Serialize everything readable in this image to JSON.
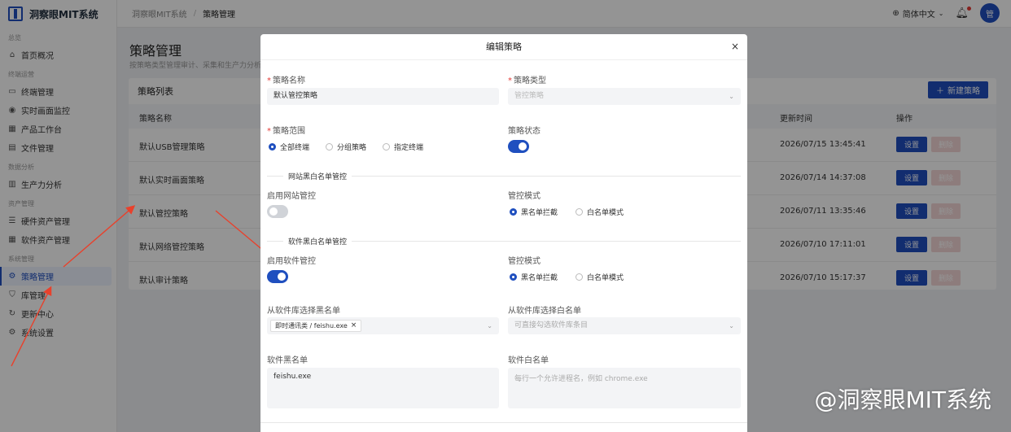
{
  "app": {
    "name": "洞察眼MIT系统"
  },
  "sidebar": {
    "groups": [
      {
        "label": "总览",
        "items": [
          {
            "label": "首页概况",
            "icon": "home-icon"
          }
        ]
      },
      {
        "label": "终端运营",
        "items": [
          {
            "label": "终端管理",
            "icon": "monitor-icon"
          },
          {
            "label": "实时画面监控",
            "icon": "eye-icon"
          },
          {
            "label": "产品工作台",
            "icon": "grid-icon"
          },
          {
            "label": "文件管理",
            "icon": "file-icon"
          }
        ]
      },
      {
        "label": "数据分析",
        "items": [
          {
            "label": "生产力分析",
            "icon": "bar-chart-icon"
          }
        ]
      },
      {
        "label": "资产管理",
        "items": [
          {
            "label": "硬件资产管理",
            "icon": "list-icon"
          },
          {
            "label": "软件资产管理",
            "icon": "grid-icon"
          }
        ]
      },
      {
        "label": "系统管理",
        "items": [
          {
            "label": "策略管理",
            "icon": "gear-icon",
            "active": true
          },
          {
            "label": "库管理",
            "icon": "shield-icon"
          },
          {
            "label": "更新中心",
            "icon": "refresh-icon"
          },
          {
            "label": "系统设置",
            "icon": "gear-icon"
          }
        ]
      }
    ]
  },
  "topbar": {
    "breadcrumb": [
      "洞察眼MIT系统",
      "策略管理"
    ],
    "language": "简体中文",
    "avatar": "管"
  },
  "page": {
    "title": "策略管理",
    "desc": "按策略类型管理审计、采集和生产力分析",
    "card_title": "策略列表",
    "new_button": "新建策略",
    "columns": {
      "name": "策略名称",
      "updated": "更新时间",
      "actions": "操作"
    },
    "rows": [
      {
        "name": "默认USB管理策略",
        "updated": "2026/07/15 13:45:41"
      },
      {
        "name": "默认实时画面策略",
        "updated": "2026/07/14 14:37:08"
      },
      {
        "name": "默认管控策略",
        "updated": "2026/07/11 13:35:46"
      },
      {
        "name": "默认网络管控策略",
        "updated": "2026/07/10 17:11:01"
      },
      {
        "name": "默认审计策略",
        "updated": "2026/07/10 15:17:37"
      }
    ],
    "set_label": "设置",
    "delete_label": "删除"
  },
  "modal": {
    "title": "编辑策略",
    "close": "×",
    "name_label": "策略名称",
    "name_value": "默认管控策略",
    "type_label": "策略类型",
    "type_value": "管控策略",
    "scope_label": "策略范围",
    "scope_options": [
      "全部终端",
      "分组策略",
      "指定终端"
    ],
    "status_label": "策略状态",
    "web_section": "网站黑白名单管控",
    "web_enable_label": "启用网站管控",
    "web_mode_label": "管控模式",
    "mode_options": [
      "黑名单拦截",
      "白名单模式"
    ],
    "sw_section": "软件黑白名单管控",
    "sw_enable_label": "启用软件管控",
    "sw_mode_label": "管控模式",
    "bl_select_label": "从软件库选择黑名单",
    "bl_tag": "即时通讯类 / feishu.exe",
    "wl_select_label": "从软件库选择白名单",
    "wl_select_placeholder": "可直接勾选软件库条目",
    "bl_text_label": "软件黑名单",
    "bl_text_value": "feishu.exe",
    "wl_text_label": "软件白名单",
    "wl_text_placeholder": "每行一个允许进程名，例如 chrome.exe"
  },
  "watermark": "@洞察眼MIT系统",
  "colors": {
    "primary": "#1f4fbf",
    "danger_light": "#f3d6d6",
    "arrow": "#e8412c"
  }
}
